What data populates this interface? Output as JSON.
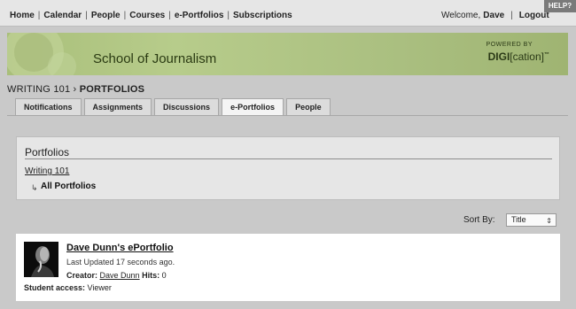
{
  "nav": {
    "items": [
      "Home",
      "Calendar",
      "People",
      "Courses",
      "e-Portfolios",
      "Subscriptions"
    ],
    "welcome_prefix": "Welcome,",
    "user": "Dave",
    "separator": "|",
    "logout": "Logout",
    "help": "HELP?"
  },
  "banner": {
    "school_name": "School of Journalism",
    "powered_by": "POWERED BY",
    "brand_main": "DIGI",
    "brand_rest": "[cation]",
    "brand_tm": "™"
  },
  "breadcrumb": {
    "course": "WRITING 101",
    "arrow": "›",
    "current": "PORTFOLIOS"
  },
  "tabs": [
    {
      "label": "Notifications",
      "active": false
    },
    {
      "label": "Assignments",
      "active": false
    },
    {
      "label": "Discussions",
      "active": false
    },
    {
      "label": "e-Portfolios",
      "active": true
    },
    {
      "label": "People",
      "active": false
    }
  ],
  "portfolios_panel": {
    "title": "Portfolios",
    "parent_link": "Writing 101",
    "arrow": "↳",
    "current": "All Portfolios"
  },
  "sort": {
    "label": "Sort By:",
    "selected": "Title"
  },
  "portfolio_card": {
    "title": "Dave Dunn's ePortfolio",
    "updated": "Last Updated 17 seconds ago.",
    "creator_label": "Creator:",
    "creator_name": "Dave Dunn",
    "hits_label": "Hits:",
    "hits": "0",
    "access_label": "Student access:",
    "access_value": "Viewer"
  },
  "colors": {
    "banner_green": "#b7cc8b",
    "page_bg": "#c9c9c9",
    "topbar_bg": "#e6e6e6"
  }
}
